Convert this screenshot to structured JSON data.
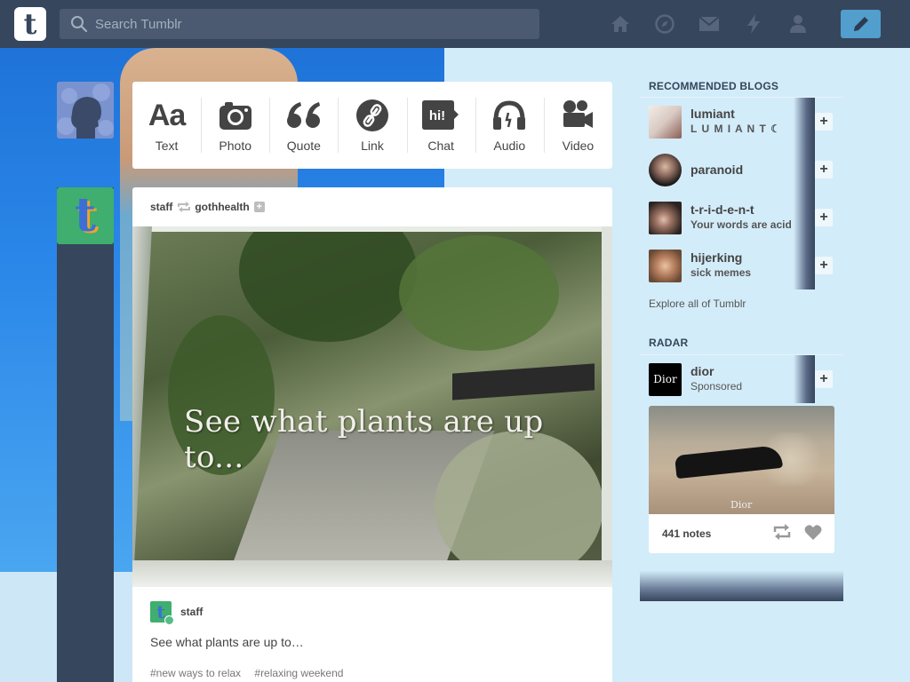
{
  "search": {
    "placeholder": "Search Tumblr"
  },
  "nav": {
    "logo": "t"
  },
  "post_types": [
    {
      "label": "Text",
      "glyph": "Aa"
    },
    {
      "label": "Photo"
    },
    {
      "label": "Quote",
      "glyph": "❝"
    },
    {
      "label": "Link"
    },
    {
      "label": "Chat",
      "glyph": "hi!"
    },
    {
      "label": "Audio"
    },
    {
      "label": "Video"
    }
  ],
  "post": {
    "poster": "staff",
    "reblogged_from": "gothhealth",
    "image_caption": "See what plants are up to...",
    "author": "staff",
    "body": "See what plants are up to…",
    "tags": [
      "#new ways to relax",
      "#relaxing weekend"
    ]
  },
  "sidebar": {
    "recommended_title": "RECOMMENDED BLOGS",
    "blogs": [
      {
        "name": "lumiant",
        "subtitle": "L U M I A N T ☾"
      },
      {
        "name": "paranoid",
        "subtitle": ""
      },
      {
        "name": "t-r-i-d-e-n-t",
        "subtitle": "Your words are acid"
      },
      {
        "name": "hijerking",
        "subtitle": "sick memes"
      }
    ],
    "explore": "Explore all of Tumblr",
    "radar_title": "RADAR",
    "radar": {
      "name": "dior",
      "avatar_text": "Dior",
      "sponsored": "Sponsored",
      "watermark": "Dior",
      "notes": "441 notes"
    }
  },
  "colors": {
    "navy": "#36465d",
    "blue_accent": "#529ecc",
    "background": "#d3ecf9"
  }
}
